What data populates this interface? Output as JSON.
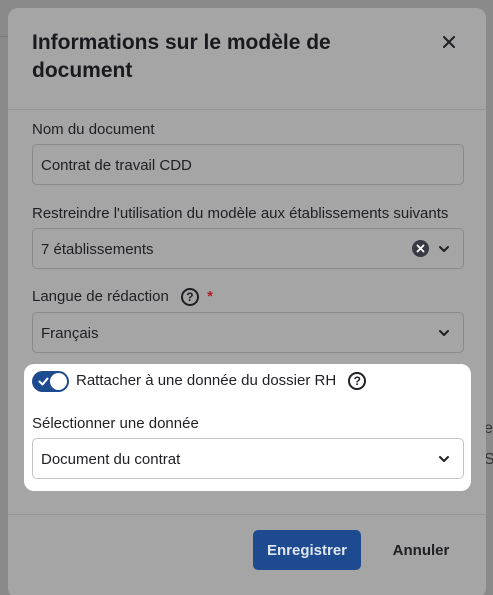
{
  "modal": {
    "title": "Informations sur le modèle de document",
    "close_icon": "close-icon",
    "fields": {
      "document_name": {
        "label": "Nom du document",
        "value": "Contrat de travail CDD"
      },
      "restrict_establishments": {
        "label": "Restreindre l'utilisation du modèle aux établissements suivants",
        "value": "7 établissements"
      },
      "language": {
        "label": "Langue de rédaction",
        "required_mark": "*",
        "value": "Français"
      }
    },
    "hr_link": {
      "toggle_label": "Rattacher à une donnée du dossier RH",
      "toggle_on": true,
      "select_label": "Sélectionner une donnée",
      "select_value": "Document du contrat"
    },
    "footer": {
      "save_label": "Enregistrer",
      "cancel_label": "Annuler"
    }
  },
  "background": {
    "fragment_1": "S",
    "fragment_2": "e"
  },
  "colors": {
    "primary": "#1e4b8f",
    "required": "#b0202c",
    "overlay": "#a5a5a5"
  }
}
